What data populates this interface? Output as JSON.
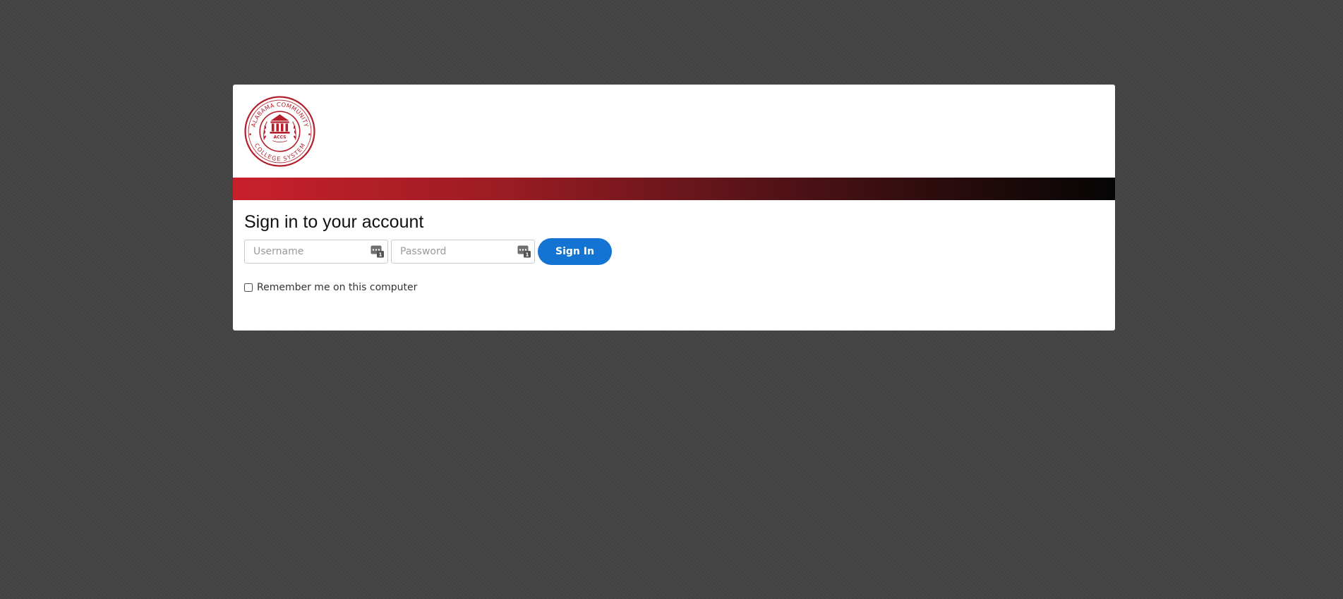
{
  "logo": {
    "name": "Alabama Community College System seal",
    "ring_text_top": "ALABAMA COMMUNITY",
    "ring_text_bottom": "COLLEGE SYSTEM",
    "center_text": "ACCS",
    "color": "#b3202c"
  },
  "band": {
    "color_start": "#c8202b",
    "color_end": "#050505"
  },
  "signin": {
    "title": "Sign in to your account",
    "username_placeholder": "Username",
    "password_placeholder": "Password",
    "button_label": "Sign In",
    "button_color": "#1474d4",
    "remember_label": "Remember me on this computer",
    "remember_checked": false
  },
  "icons": {
    "field_icon": "password-manager-key-icon"
  }
}
